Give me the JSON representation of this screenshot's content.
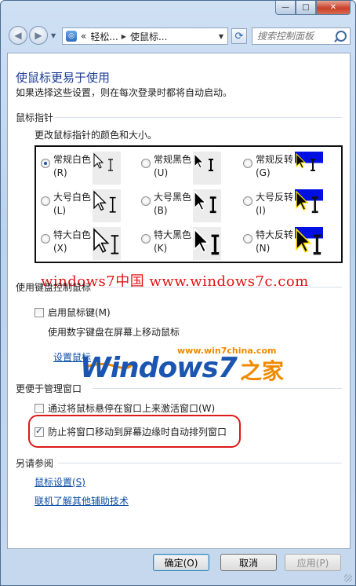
{
  "window": {
    "minimize_glyph": "—",
    "maximize_glyph": "□",
    "close_glyph": "✕"
  },
  "nav": {
    "back_glyph": "◀",
    "forward_glyph": "▶",
    "address_chevron": "«",
    "breadcrumb": [
      "轻松...",
      "使鼠标..."
    ],
    "refresh_glyph": "⟳",
    "search_placeholder": "搜索控制面板"
  },
  "page": {
    "title": "使鼠标更易于使用",
    "description": "如果选择这些设置，则在每次登录时都将自动启动。"
  },
  "pointer_section": {
    "heading": "鼠标指针",
    "subheading": "更改鼠标指针的颜色和大小。",
    "options": [
      {
        "label": "常规白色(R)",
        "selected": true,
        "style": "white",
        "size": "regular"
      },
      {
        "label": "常规黑色(U)",
        "selected": false,
        "style": "black",
        "size": "regular"
      },
      {
        "label": "常规反转(G)",
        "selected": false,
        "style": "inverted",
        "size": "regular"
      },
      {
        "label": "大号白色(L)",
        "selected": false,
        "style": "white",
        "size": "large"
      },
      {
        "label": "大号黑色(B)",
        "selected": false,
        "style": "black",
        "size": "large"
      },
      {
        "label": "大号反转(I)",
        "selected": false,
        "style": "inverted",
        "size": "large"
      },
      {
        "label": "特大白色(X)",
        "selected": false,
        "style": "white",
        "size": "extra-large"
      },
      {
        "label": "特大黑色(K)",
        "selected": false,
        "style": "black",
        "size": "extra-large"
      },
      {
        "label": "特大反转(N)",
        "selected": false,
        "style": "inverted",
        "size": "extra-large"
      }
    ]
  },
  "watermark_text": "windows7中国 www.windows7c.com",
  "keyboard_section": {
    "heading": "使用键盘控制鼠标",
    "mouse_keys_label": "启用鼠标键(M)",
    "mouse_keys_checked": false,
    "mouse_keys_desc": "使用数字键盘在屏幕上移动鼠标",
    "setup_link": "设置鼠标"
  },
  "logo": {
    "url": "www.win7china.com",
    "brand": "Windows7",
    "brand_cn": "之家"
  },
  "window_section": {
    "heading": "更便于管理窗口",
    "hover_label": "通过将鼠标悬停在窗口上来激活窗口(W)",
    "hover_checked": false,
    "snap_label": "防止将窗口移动到屏幕边缘时自动排列窗口",
    "snap_checked": true
  },
  "see_also": {
    "heading": "另请参阅",
    "links": [
      "鼠标设置(S)",
      "联机了解其他辅助技术"
    ]
  },
  "buttons": {
    "ok": "确定(O)",
    "cancel": "取消",
    "apply": "应用(P)"
  },
  "colors": {
    "title": "#1e3c96",
    "link": "#0a4ea6",
    "watermark": "#e31414",
    "highlight": "#dd1818",
    "logo_blue": "#1b55b2",
    "logo_orange": "#f08a00"
  }
}
